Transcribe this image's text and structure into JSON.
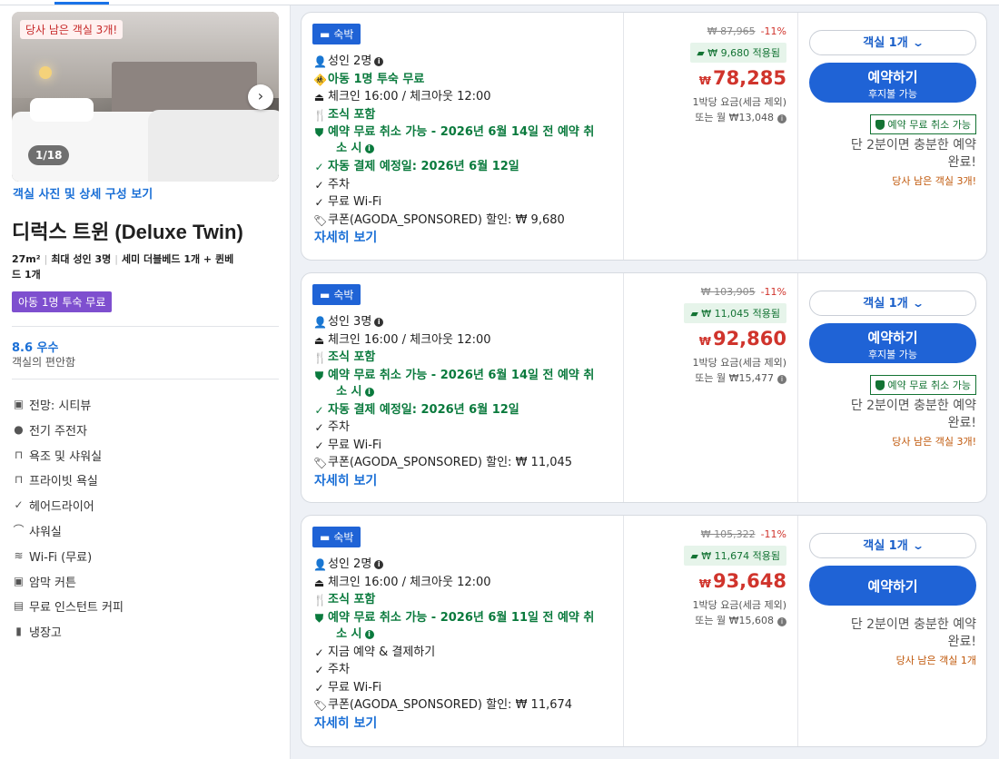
{
  "left": {
    "photo_badge": "당사 남은 객실 3개!",
    "photo_counter": "1/18",
    "photo_link": "객실 사진 및 상세 구성 보기",
    "room_name": "디럭스 트윈 (Deluxe Twin)",
    "specs": {
      "size": "27m²",
      "max_adults": "최대 성인 3명",
      "beds_line1": "세미 더블베드 1개 + 퀸베",
      "beds_line2": "드 1개"
    },
    "kid_badge": "아동 1명 투숙 무료",
    "score": "8.6 우수",
    "score_sub": "객실의 편안함",
    "amenities": [
      {
        "icon": "view-icon",
        "glyph": "▣",
        "label": "전망: 시티뷰"
      },
      {
        "icon": "ev-charger-icon",
        "glyph": "●",
        "label": "전기 주전자"
      },
      {
        "icon": "bathtub-icon",
        "glyph": "⊓",
        "label": "욕조 및 샤워실"
      },
      {
        "icon": "private-bath-icon",
        "glyph": "⊓",
        "label": "프라이빗 욕실"
      },
      {
        "icon": "check-icon",
        "glyph": "✓",
        "label": "헤어드라이어"
      },
      {
        "icon": "shower-icon",
        "glyph": "⌒",
        "label": "샤워실"
      },
      {
        "icon": "wifi-icon",
        "glyph": "≋",
        "label": "Wi-Fi (무료)"
      },
      {
        "icon": "curtain-icon",
        "glyph": "▣",
        "label": "암막 커튼"
      },
      {
        "icon": "coffee-icon",
        "glyph": "▤",
        "label": "무료 인스턴트 커피"
      },
      {
        "icon": "fridge-icon",
        "glyph": "▮",
        "label": "냉장고"
      }
    ]
  },
  "offers": [
    {
      "chip": "숙박",
      "features": [
        {
          "icon": "person-icon",
          "glyph": "👤",
          "text": "성인 2명",
          "green": false,
          "info": true
        },
        {
          "icon": "child-icon",
          "glyph": "🚸",
          "text": "아동 1명 투숙 무료",
          "green": true,
          "info": false
        },
        {
          "icon": "checkin-icon",
          "glyph": "⏏",
          "text": "체크인 16:00 / 체크아웃 12:00",
          "green": false,
          "info": false
        },
        {
          "icon": "meal-icon",
          "glyph": "🍴",
          "text": "조식 포함",
          "green": true,
          "info": false
        },
        {
          "icon": "shield-icon",
          "glyph": "⛊",
          "text": "예약 무료 취소 가능 - 2026년 6월 14일 전 예약 취",
          "text2": "소 시",
          "green": true,
          "info": true
        },
        {
          "icon": "check-icon",
          "glyph": "✓",
          "text": "자동 결제 예정일: 2026년 6월 12일",
          "green": true,
          "info": false
        },
        {
          "icon": "check-icon",
          "glyph": "✓",
          "text": "주차",
          "green": false,
          "info": false
        },
        {
          "icon": "check-icon",
          "glyph": "✓",
          "text": "무료 Wi-Fi",
          "green": false,
          "info": false
        },
        {
          "icon": "tag-icon",
          "glyph": "🏷",
          "text": "쿠폰(AGODA_SPONSORED) 할인: ₩ 9,680",
          "green": false,
          "info": false
        }
      ],
      "more": "자세히 보기",
      "old_price": "₩ 87,965",
      "discount": "-11%",
      "coupon": "₩ 9,680 적용됨",
      "currency": "₩",
      "price": "78,285",
      "per_night": "1박당 요금(세금 제외)",
      "monthly": "또는 월 ₩13,048",
      "rooms": "객실 1개",
      "book": "예약하기",
      "book_sub": "후지불 가능",
      "free_cancel": "예약 무료 취소 가능",
      "quick1": "단 2분이면 충분한 예약",
      "quick2": "완료!",
      "left_rooms": "당사 남은 객실 3개!"
    },
    {
      "chip": "숙박",
      "features": [
        {
          "icon": "person-icon",
          "glyph": "👤",
          "text": "성인 3명",
          "green": false,
          "info": true
        },
        {
          "icon": "checkin-icon",
          "glyph": "⏏",
          "text": "체크인 16:00 / 체크아웃 12:00",
          "green": false,
          "info": false
        },
        {
          "icon": "meal-icon",
          "glyph": "🍴",
          "text": "조식 포함",
          "green": true,
          "info": false
        },
        {
          "icon": "shield-icon",
          "glyph": "⛊",
          "text": "예약 무료 취소 가능 - 2026년 6월 14일 전 예약 취",
          "text2": "소 시",
          "green": true,
          "info": true
        },
        {
          "icon": "check-icon",
          "glyph": "✓",
          "text": "자동 결제 예정일: 2026년 6월 12일",
          "green": true,
          "info": false
        },
        {
          "icon": "check-icon",
          "glyph": "✓",
          "text": "주차",
          "green": false,
          "info": false
        },
        {
          "icon": "check-icon",
          "glyph": "✓",
          "text": "무료 Wi-Fi",
          "green": false,
          "info": false
        },
        {
          "icon": "tag-icon",
          "glyph": "🏷",
          "text": "쿠폰(AGODA_SPONSORED) 할인: ₩ 11,045",
          "green": false,
          "info": false
        }
      ],
      "more": "자세히 보기",
      "old_price": "₩ 103,905",
      "discount": "-11%",
      "coupon": "₩ 11,045 적용됨",
      "currency": "₩",
      "price": "92,860",
      "per_night": "1박당 요금(세금 제외)",
      "monthly": "또는 월 ₩15,477",
      "rooms": "객실 1개",
      "book": "예약하기",
      "book_sub": "후지불 가능",
      "free_cancel": "예약 무료 취소 가능",
      "quick1": "단 2분이면 충분한 예약",
      "quick2": "완료!",
      "left_rooms": "당사 남은 객실 3개!"
    },
    {
      "chip": "숙박",
      "features": [
        {
          "icon": "person-icon",
          "glyph": "👤",
          "text": "성인 2명",
          "green": false,
          "info": true
        },
        {
          "icon": "checkin-icon",
          "glyph": "⏏",
          "text": "체크인 16:00 / 체크아웃 12:00",
          "green": false,
          "info": false
        },
        {
          "icon": "meal-icon",
          "glyph": "🍴",
          "text": "조식 포함",
          "green": true,
          "info": false
        },
        {
          "icon": "shield-icon",
          "glyph": "⛊",
          "text": "예약 무료 취소 가능 - 2026년 6월 11일 전 예약 취",
          "text2": "소 시",
          "green": true,
          "info": true
        },
        {
          "icon": "check-icon",
          "glyph": "✓",
          "text": "지금 예약 & 결제하기",
          "green": false,
          "info": false
        },
        {
          "icon": "check-icon",
          "glyph": "✓",
          "text": "주차",
          "green": false,
          "info": false
        },
        {
          "icon": "check-icon",
          "glyph": "✓",
          "text": "무료 Wi-Fi",
          "green": false,
          "info": false
        },
        {
          "icon": "tag-icon",
          "glyph": "🏷",
          "text": "쿠폰(AGODA_SPONSORED) 할인: ₩ 11,674",
          "green": false,
          "info": false
        }
      ],
      "more": "자세히 보기",
      "old_price": "₩ 105,322",
      "discount": "-11%",
      "coupon": "₩ 11,674 적용됨",
      "currency": "₩",
      "price": "93,648",
      "per_night": "1박당 요금(세금 제외)",
      "monthly": "또는 월 ₩15,608",
      "rooms": "객실 1개",
      "book": "예약하기",
      "book_sub": "",
      "free_cancel": "",
      "quick1": "단 2분이면 충분한 예약",
      "quick2": "완료!",
      "left_rooms": "당사 남은 객실 1개"
    }
  ]
}
